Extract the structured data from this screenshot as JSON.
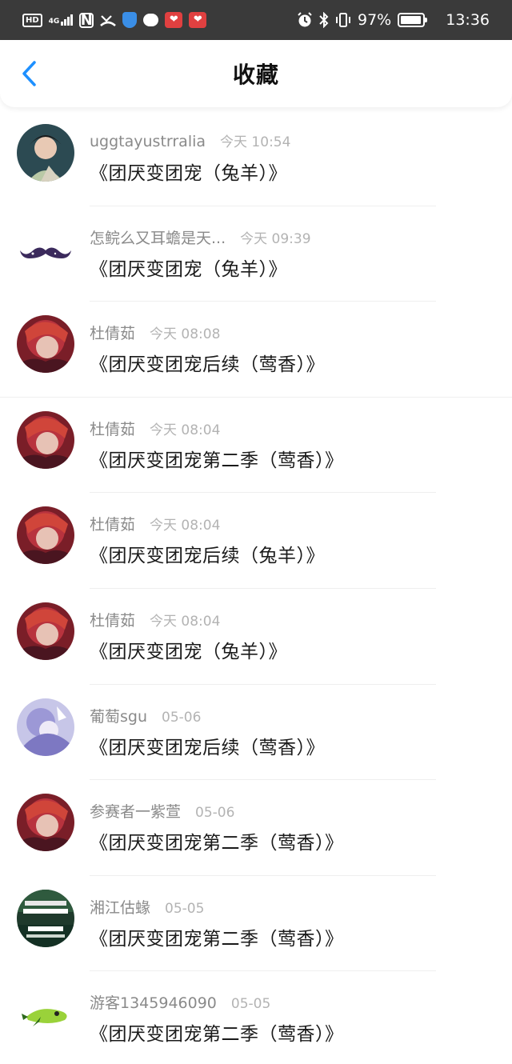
{
  "status_bar": {
    "hd": "HD",
    "network": "4G",
    "battery_percent": "97%",
    "battery_level": 0.97,
    "time": "13:36",
    "heart_badge": "❤"
  },
  "header": {
    "title": "收藏",
    "back_icon": "chevron-left-icon",
    "accent_color": "#1e90ff"
  },
  "favorites": [
    {
      "author": "uggtayustrralia",
      "time": "今天 10:54",
      "title": "《团厌变团宠（兔羊）》"
    },
    {
      "author": "怎鲩么又耳蟾是天...",
      "time": "今天 09:39",
      "title": "《团厌变团宠（兔羊）》"
    },
    {
      "author": "杜倩茹",
      "time": "今天 08:08",
      "title": "《团厌变团宠后续（莺香）》"
    },
    {
      "author": "杜倩茹",
      "time": "今天 08:04",
      "title": "《团厌变团宠第二季（莺香）》"
    },
    {
      "author": "杜倩茹",
      "time": "今天 08:04",
      "title": "《团厌变团宠后续（兔羊）》"
    },
    {
      "author": "杜倩茹",
      "time": "今天 08:04",
      "title": "《团厌变团宠（兔羊）》"
    },
    {
      "author": "葡萄sgu",
      "time": "05-06",
      "title": "《团厌变团宠后续（莺香）》"
    },
    {
      "author": "参赛者一紫萱",
      "time": "05-06",
      "title": "《团厌变团宠第二季（莺香）》"
    },
    {
      "author": "湘江估蝝",
      "time": "05-05",
      "title": "《团厌变团宠第二季（莺香）》"
    },
    {
      "author": "游客1345946090",
      "time": "05-05",
      "title": "《团厌变团宠第二季（莺香）》"
    }
  ]
}
